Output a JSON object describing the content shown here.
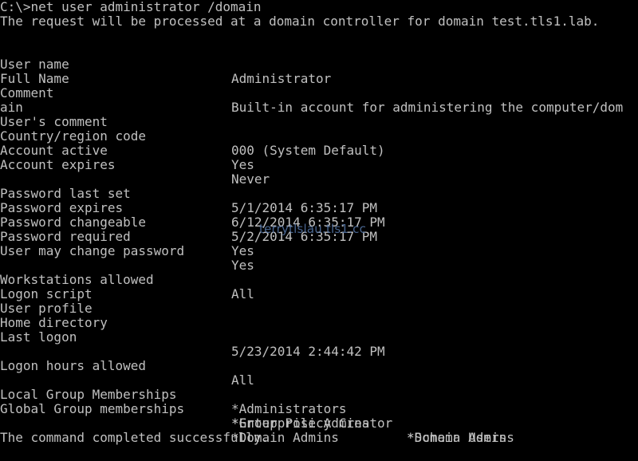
{
  "console": {
    "command_line": "C:\\>net user administrator /domain",
    "request_line": "The request will be processed at a domain controller for domain test.tls1.lab.",
    "fields": {
      "user_name": {
        "label": "User name",
        "value": "Administrator"
      },
      "full_name": {
        "label": "Full Name",
        "value": ""
      },
      "comment": {
        "label": "Comment",
        "value": "Built-in account for administering the computer/dom",
        "wrap": "ain"
      },
      "users_comment": {
        "label": "User's comment",
        "value": ""
      },
      "country_code": {
        "label": "Country/region code",
        "value": "000 (System Default)"
      },
      "account_active": {
        "label": "Account active",
        "value": "Yes"
      },
      "account_expires": {
        "label": "Account expires",
        "value": "Never"
      },
      "password_last_set": {
        "label": "Password last set",
        "value": "5/1/2014 6:35:17 PM"
      },
      "password_expires": {
        "label": "Password expires",
        "value": "6/12/2014 6:35:17 PM"
      },
      "password_changeable": {
        "label": "Password changeable",
        "value": "5/2/2014 6:35:17 PM"
      },
      "password_required": {
        "label": "Password required",
        "value": "Yes"
      },
      "user_may_change_password": {
        "label": "User may change password",
        "value": "Yes"
      },
      "workstations_allowed": {
        "label": "Workstations allowed",
        "value": "All"
      },
      "logon_script": {
        "label": "Logon script",
        "value": ""
      },
      "user_profile": {
        "label": "User profile",
        "value": ""
      },
      "home_directory": {
        "label": "Home directory",
        "value": ""
      },
      "last_logon": {
        "label": "Last logon",
        "value": "5/23/2014 2:44:42 PM"
      },
      "logon_hours_allowed": {
        "label": "Logon hours allowed",
        "value": "All"
      },
      "local_groups": {
        "label": "Local Group Memberships",
        "value": "*Administrators"
      },
      "global_groups": {
        "label": "Global Group memberships",
        "col1": [
          "*Group Policy Creator",
          "*Enterprise Admins",
          "*Domain Admins"
        ],
        "col2": [
          "*Domain Users",
          "*Schema Admins"
        ]
      }
    },
    "completion_line": "The command completed successfully.",
    "watermark": "terrytlslau.tls1.cc"
  },
  "colors": {
    "background": "#000000",
    "text": "#c0c0c0",
    "watermark": "#5577aa"
  }
}
